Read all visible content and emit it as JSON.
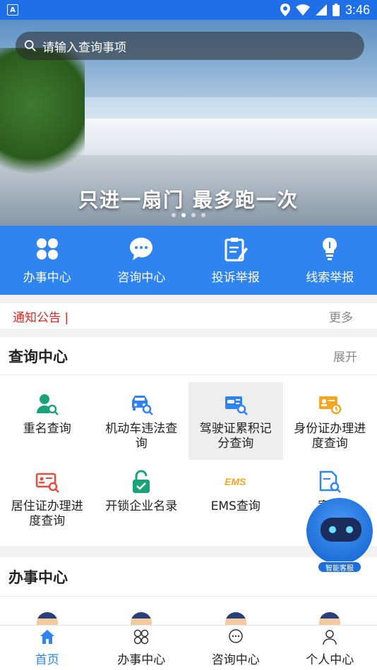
{
  "status_bar": {
    "time": "3:46",
    "app_badge": "A",
    "icons": [
      "location-icon",
      "wifi-icon",
      "signal-icon",
      "battery-icon"
    ]
  },
  "banner": {
    "slogan": "只进一扇门  最多跑一次",
    "page_count": 4,
    "active_index": 1
  },
  "search": {
    "placeholder": "请输入查询事项"
  },
  "quick_nav": [
    {
      "label": "办事中心",
      "icon": "apps-icon"
    },
    {
      "label": "咨询中心",
      "icon": "chat-icon"
    },
    {
      "label": "投诉举报",
      "icon": "clipboard-edit-icon"
    },
    {
      "label": "线索举报",
      "icon": "lightbulb-icon"
    }
  ],
  "notice": {
    "label": "通知公告 |",
    "more": "更多"
  },
  "query_center": {
    "title": "查询中心",
    "expand": "展开",
    "items": [
      {
        "label": "重名查询",
        "icon": "person-search-icon",
        "color": "#1aa37a"
      },
      {
        "label": "机动车违法查询",
        "icon": "car-search-icon",
        "color": "#2f84f0"
      },
      {
        "label": "驾驶证累积记分查询",
        "icon": "license-search-icon",
        "color": "#2f84f0"
      },
      {
        "label": "身份证办理进度查询",
        "icon": "id-card-clock-icon",
        "color": "#f5a623"
      },
      {
        "label": "居住证办理进度查询",
        "icon": "residence-card-search-icon",
        "color": "#e84a3c"
      },
      {
        "label": "开锁企业名录",
        "icon": "unlock-icon",
        "color": "#1aa37a"
      },
      {
        "label": "EMS查询",
        "icon": "ems-icon",
        "color": "#f5a623"
      },
      {
        "label": "案件",
        "icon": "document-search-icon",
        "color": "#2f84f0"
      }
    ]
  },
  "office_center": {
    "title": "办事中心"
  },
  "robot": {
    "badge": "智能客服"
  },
  "tabbar": [
    {
      "label": "首页",
      "icon": "home-icon",
      "active": true
    },
    {
      "label": "办事中心",
      "icon": "apps-icon",
      "active": false
    },
    {
      "label": "咨询中心",
      "icon": "chat-icon",
      "active": false
    },
    {
      "label": "个人中心",
      "icon": "person-icon",
      "active": false
    }
  ],
  "colors": {
    "primary": "#2f84f0",
    "status_bar": "#1f6fe8",
    "notice_red": "#e0261f"
  }
}
